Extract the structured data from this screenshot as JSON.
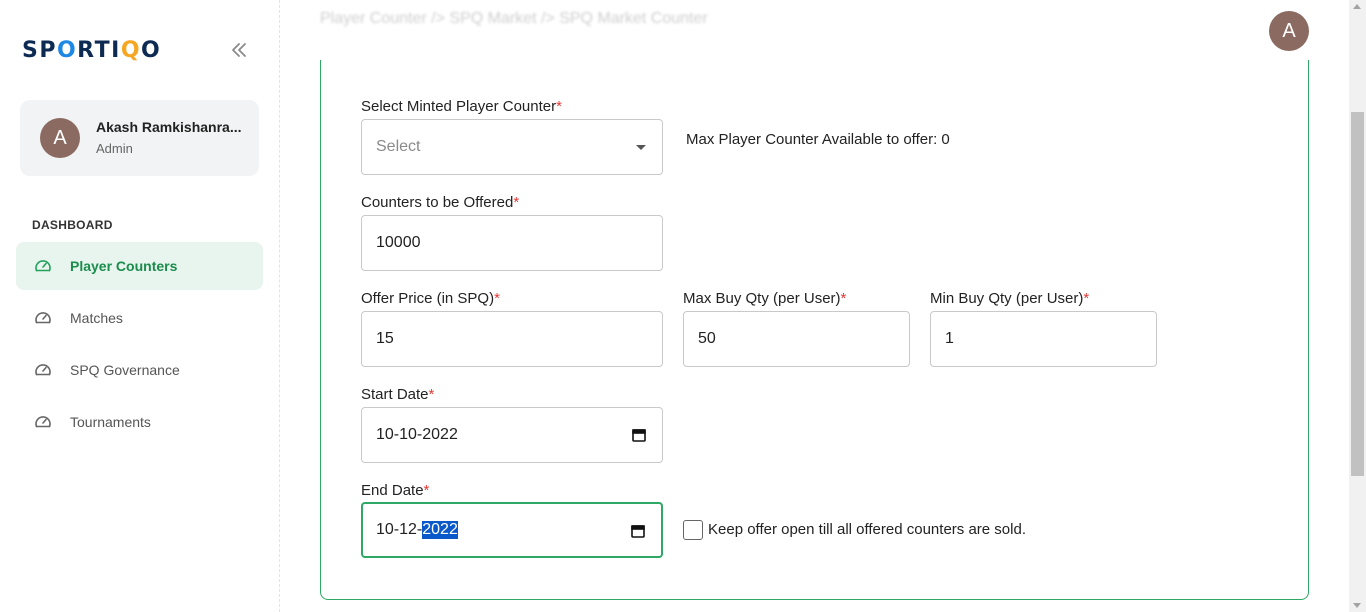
{
  "brand": {
    "logo_text_a": "SP",
    "logo_o1": "O",
    "logo_text_b": "RTI",
    "logo_q": "Q",
    "logo_o2": "O"
  },
  "user": {
    "initial": "A",
    "name": "Akash Ramkishanra...",
    "role": "Admin"
  },
  "sidebar": {
    "section_title": "DASHBOARD",
    "items": [
      {
        "label": "Player Counters",
        "icon": "gauge-icon",
        "active": true
      },
      {
        "label": "Matches",
        "icon": "gauge-icon",
        "active": false
      },
      {
        "label": "SPQ Governance",
        "icon": "gauge-icon",
        "active": false
      },
      {
        "label": "Tournaments",
        "icon": "gauge-icon",
        "active": false
      }
    ]
  },
  "header": {
    "title": "Player Counter  />  SPQ Market  />  SPQ Market Counter",
    "avatar_initial": "A"
  },
  "form": {
    "minted_counter": {
      "label": "Select Minted Player Counter",
      "placeholder": "Select"
    },
    "max_available_text": "Max Player Counter Available to offer: 0",
    "counters_offered": {
      "label": "Counters to be Offered",
      "value": "10000"
    },
    "offer_price": {
      "label": "Offer Price (in SPQ)",
      "value": "15"
    },
    "max_buy": {
      "label": "Max Buy Qty (per User)",
      "value": "50"
    },
    "min_buy": {
      "label": "Min Buy Qty (per User)",
      "value": "1"
    },
    "start_date": {
      "label": "Start Date",
      "value": "10-10-2022"
    },
    "end_date": {
      "label": "End Date",
      "value_prefix": "10-12-",
      "value_selected": "2022"
    },
    "keep_open": {
      "label": "Keep offer open till all offered counters are sold.",
      "checked": false
    },
    "required_mark": "*"
  },
  "colors": {
    "accent": "#2fa866",
    "active_bg": "#e8f5ee",
    "required": "#e53935",
    "avatar": "#8b6b61",
    "brand_navy": "#0d2b52"
  }
}
